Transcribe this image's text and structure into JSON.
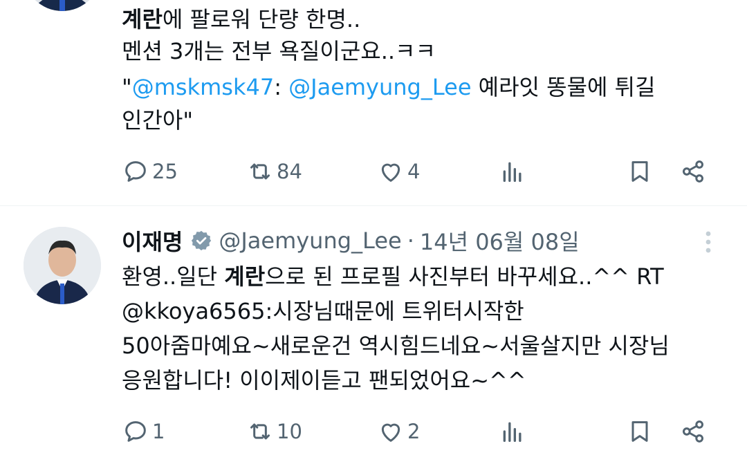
{
  "tweet1": {
    "lines": [
      {
        "bold": "계란",
        "rest": "에 팔로워 단량 한명.."
      },
      {
        "text": "멘션 3개는 전부 욕질이군요..ㅋㅋ"
      },
      {
        "q1": "\"",
        "mention1": "@mskmsk47",
        "sep": ": ",
        "mention2": "@Jaemyung_Lee",
        "rest": " 예라잇 똥물에 튀길"
      },
      {
        "text": "인간아\""
      }
    ],
    "actions": {
      "replies": "25",
      "retweets": "84",
      "likes": "4"
    }
  },
  "tweet2": {
    "name": "이재명",
    "handle": "@Jaemyung_Lee",
    "dot": "·",
    "date": "14년 06월 08일",
    "lines": [
      {
        "pre": "환영..일단 ",
        "bold": "계란",
        "rest": "으로 된 프로필 사진부터 바꾸세요..^^ RT"
      },
      {
        "text": "@kkoya6565:시장님때문에 트위터시작한"
      },
      {
        "text": "50아줌마예요~새로운건 역시힘드네요~서울살지만 시장님"
      },
      {
        "text": "응원합니다! 이이제이듣고 팬되었어요~^^"
      }
    ],
    "actions": {
      "replies": "1",
      "retweets": "10",
      "likes": "2"
    }
  },
  "colors": {
    "link": "#1d9bf0",
    "icon": "#536471",
    "verified": "#829aab"
  },
  "icons": [
    "reply-icon",
    "retweet-icon",
    "like-icon",
    "views-icon",
    "bookmark-icon",
    "share-icon",
    "verified-icon",
    "more-icon"
  ]
}
